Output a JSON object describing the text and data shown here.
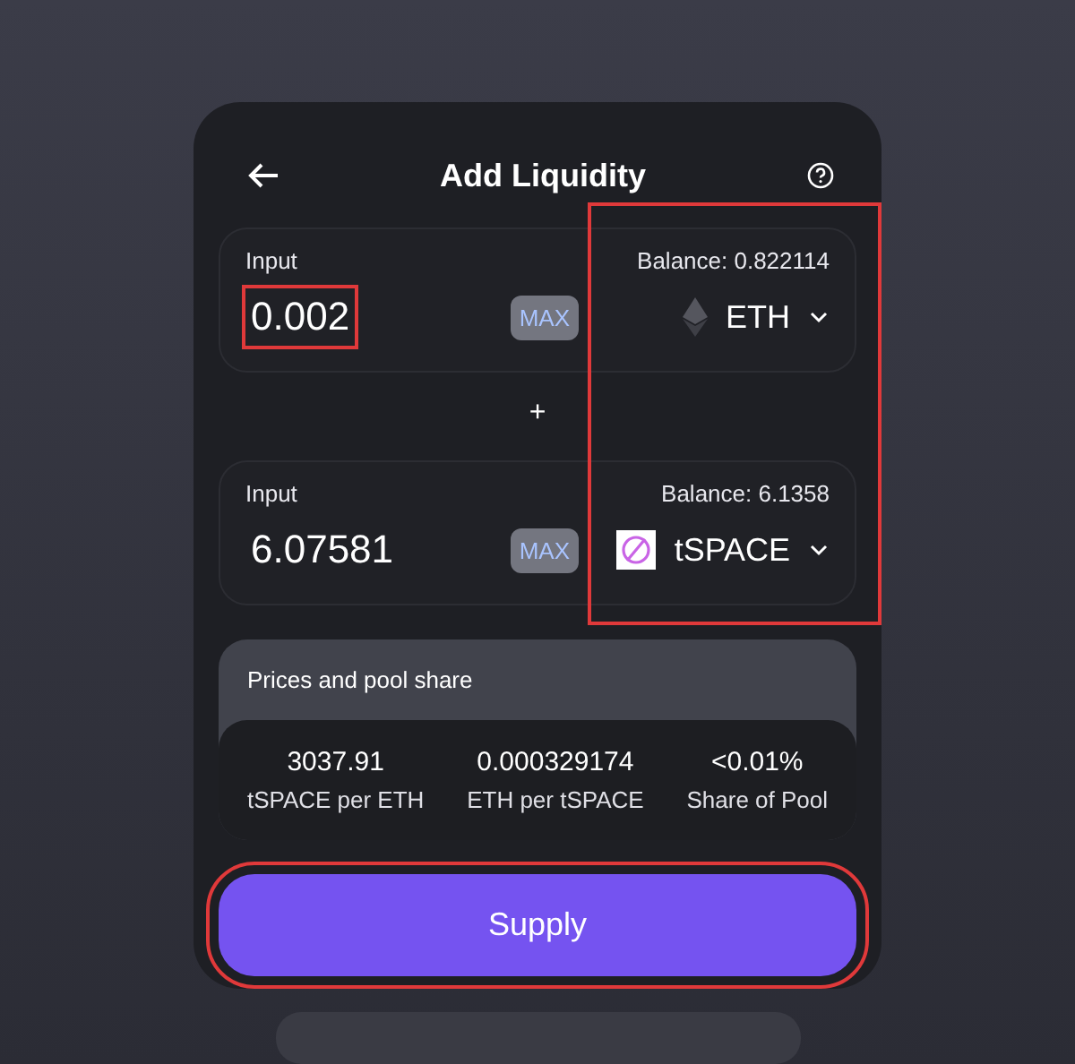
{
  "header": {
    "title": "Add Liquidity"
  },
  "inputs": [
    {
      "label": "Input",
      "balance": "Balance: 0.822114",
      "amount": "0.002",
      "max": "MAX",
      "token": "ETH",
      "kind": "eth",
      "amount_highlighted": true
    },
    {
      "label": "Input",
      "balance": "Balance: 6.1358",
      "amount": "6.07581",
      "max": "MAX",
      "token": "tSPACE",
      "kind": "space",
      "amount_highlighted": false
    }
  ],
  "plus": "+",
  "token_column_highlighted": true,
  "prices": {
    "title": "Prices and pool share",
    "items": [
      {
        "value": "3037.91",
        "label": "tSPACE per ETH"
      },
      {
        "value": "0.000329174",
        "label": "ETH per tSPACE"
      },
      {
        "value": "<0.01%",
        "label": "Share of Pool"
      }
    ]
  },
  "supply": {
    "label": "Supply",
    "highlighted": true
  }
}
